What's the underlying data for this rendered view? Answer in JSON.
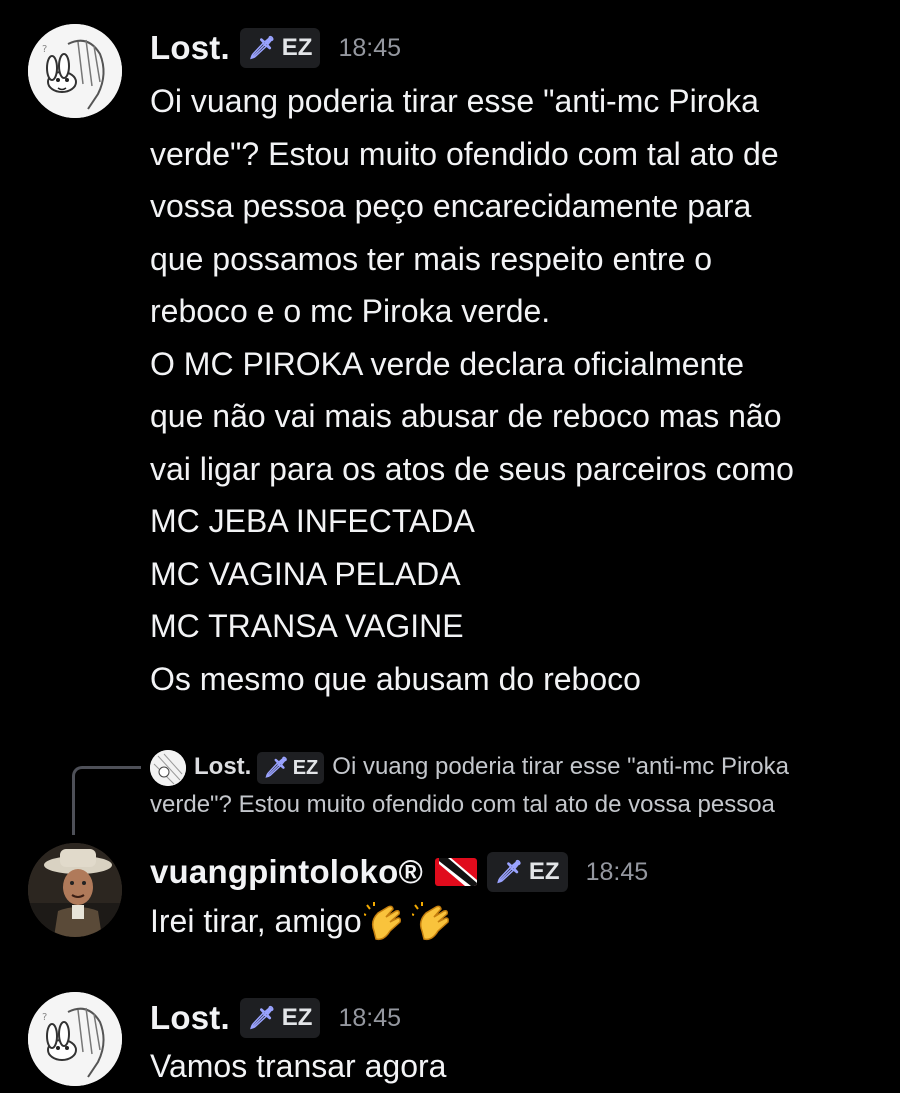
{
  "messages": [
    {
      "author": "Lost.",
      "tag": "EZ",
      "tag_icon": "sword-icon",
      "time": "18:45",
      "lines": [
        "Oi vuang poderia tirar esse \"anti-mc Piroka",
        "verde\"? Estou muito ofendido com tal ato de",
        "vossa pessoa peço encarecidamente para",
        "que possamos ter mais respeito entre o",
        "reboco e o mc Piroka verde.",
        "O MC PIROKA verde declara oficialmente",
        "que não vai mais abusar de reboco mas não",
        "vai ligar para os atos de seus parceiros como",
        "MC JEBA INFECTADA",
        "MC VAGINA PELADA",
        "MC TRANSA VAGINE",
        "Os mesmo que abusam do reboco"
      ]
    },
    {
      "reply": {
        "author": "Lost.",
        "tag": "EZ",
        "text_line1": "Oi vuang poderia tirar esse \"anti-mc Piroka",
        "text_line2": "verde\"? Estou muito ofendido com tal ato de vossa pessoa"
      },
      "author": "vuangpintoloko®",
      "flag_icon": "trinidad-tobago-flag-icon",
      "tag": "EZ",
      "time": "18:45",
      "text": "Irei tirar, amigo",
      "emoji": [
        "clapping-hands-icon",
        "clapping-hands-icon"
      ]
    },
    {
      "author": "Lost.",
      "tag": "EZ",
      "time": "18:45",
      "text": "Vamos transar agora"
    }
  ],
  "colors": {
    "background": "#000000",
    "text": "#f2f3f5",
    "timestamp": "#94979f",
    "tag_bg": "#1e1f22",
    "tag_icon": "#9aa3ff"
  }
}
